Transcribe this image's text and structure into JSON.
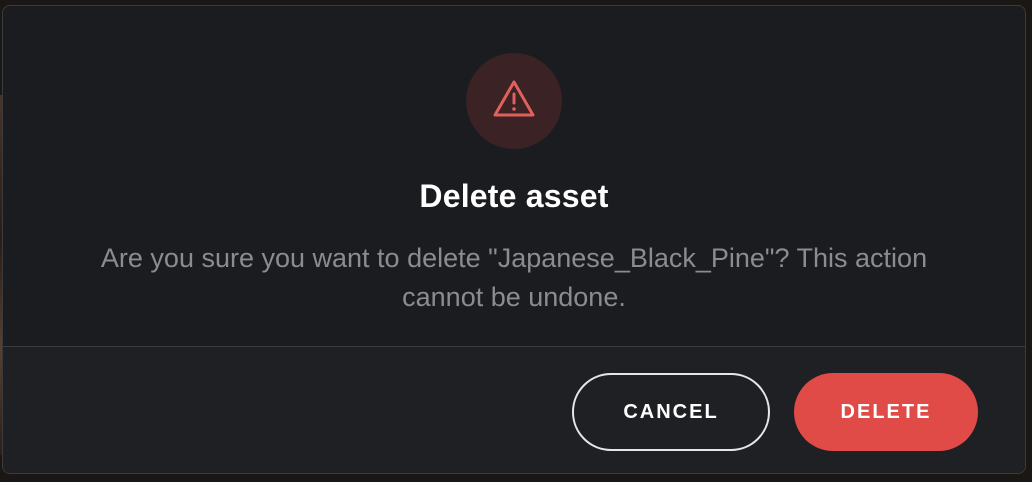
{
  "dialog": {
    "icon": "warning-triangle-icon",
    "title": "Delete asset",
    "message": "Are you sure you want to delete \"Japanese_Black_Pine\"? This action cannot be undone.",
    "cancel_label": "CANCEL",
    "delete_label": "DELETE"
  },
  "colors": {
    "danger": "#e04a47",
    "icon_bg": "#3a2225",
    "icon_stroke": "#e0605c",
    "modal_bg": "#1b1c1f"
  }
}
